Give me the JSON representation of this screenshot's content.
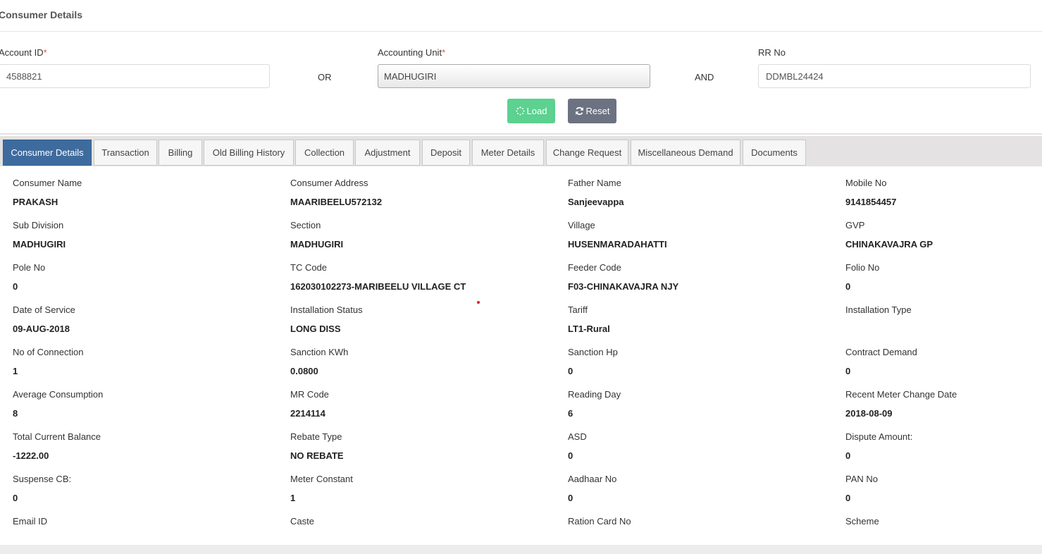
{
  "header": {
    "title": "Consumer Details"
  },
  "search": {
    "account_id": {
      "label": "Account ID",
      "required_mark": "*",
      "value": "4588821"
    },
    "or_label": "OR",
    "accounting_unit": {
      "label": "Accounting Unit",
      "required_mark": "*",
      "value": "MADHUGIRI"
    },
    "and_label": "AND",
    "rr_no": {
      "label": "RR No",
      "value": "DDMBL24424"
    },
    "load_label": "Load",
    "reset_label": "Reset",
    "load_color": "#5cd190",
    "reset_color": "#6c7281"
  },
  "tabs": [
    {
      "label": "Consumer Details",
      "active": true
    },
    {
      "label": "Transaction"
    },
    {
      "label": "Billing"
    },
    {
      "label": "Old Billing History"
    },
    {
      "label": "Collection"
    },
    {
      "label": "Adjustment"
    },
    {
      "label": "Deposit"
    },
    {
      "label": "Meter Details"
    },
    {
      "label": "Change Request"
    },
    {
      "label": "Miscellaneous Demand"
    },
    {
      "label": "Documents"
    }
  ],
  "details": [
    {
      "label": "Consumer Name",
      "value": "PRAKASH"
    },
    {
      "label": "Consumer Address",
      "value": "MAARIBEELU572132"
    },
    {
      "label": "Father Name",
      "value": "Sanjeevappa"
    },
    {
      "label": "Mobile No",
      "value": "9141854457"
    },
    {
      "label": "Sub Division",
      "value": "MADHUGIRI"
    },
    {
      "label": "Section",
      "value": "MADHUGIRI"
    },
    {
      "label": "Village",
      "value": "HUSENMARADAHATTI"
    },
    {
      "label": "GVP",
      "value": "CHINAKAVAJRA GP"
    },
    {
      "label": "Pole No",
      "value": "0"
    },
    {
      "label": "TC Code",
      "value": "162030102273-MARIBEELU VILLAGE CT"
    },
    {
      "label": "Feeder Code",
      "value": "F03-CHINAKAVAJRA NJY"
    },
    {
      "label": "Folio No",
      "value": "0"
    },
    {
      "label": "Date of Service",
      "value": "09-AUG-2018"
    },
    {
      "label": "Installation Status",
      "value": "LONG DISS"
    },
    {
      "label": "Tariff",
      "value": "LT1-Rural"
    },
    {
      "label": "Installation Type",
      "value": ""
    },
    {
      "label": "No of Connection",
      "value": "1"
    },
    {
      "label": "Sanction KWh",
      "value": "0.0800"
    },
    {
      "label": "Sanction Hp",
      "value": "0"
    },
    {
      "label": "Contract Demand",
      "value": "0"
    },
    {
      "label": "Average Consumption",
      "value": "8"
    },
    {
      "label": "MR Code",
      "value": "2214114"
    },
    {
      "label": "Reading Day",
      "value": "6"
    },
    {
      "label": "Recent Meter Change Date",
      "value": "2018-08-09"
    },
    {
      "label": "Total Current Balance",
      "value": "-1222.00"
    },
    {
      "label": "Rebate Type",
      "value": "NO REBATE"
    },
    {
      "label": "ASD",
      "value": "0"
    },
    {
      "label": "Dispute Amount:",
      "value": "0"
    },
    {
      "label": "Suspense CB:",
      "value": "0"
    },
    {
      "label": "Meter Constant",
      "value": "1"
    },
    {
      "label": "Aadhaar No",
      "value": "0"
    },
    {
      "label": "PAN No",
      "value": "0"
    },
    {
      "label": "Email ID",
      "value": ""
    },
    {
      "label": "Caste",
      "value": ""
    },
    {
      "label": "Ration Card No",
      "value": ""
    },
    {
      "label": "Scheme",
      "value": ""
    }
  ]
}
